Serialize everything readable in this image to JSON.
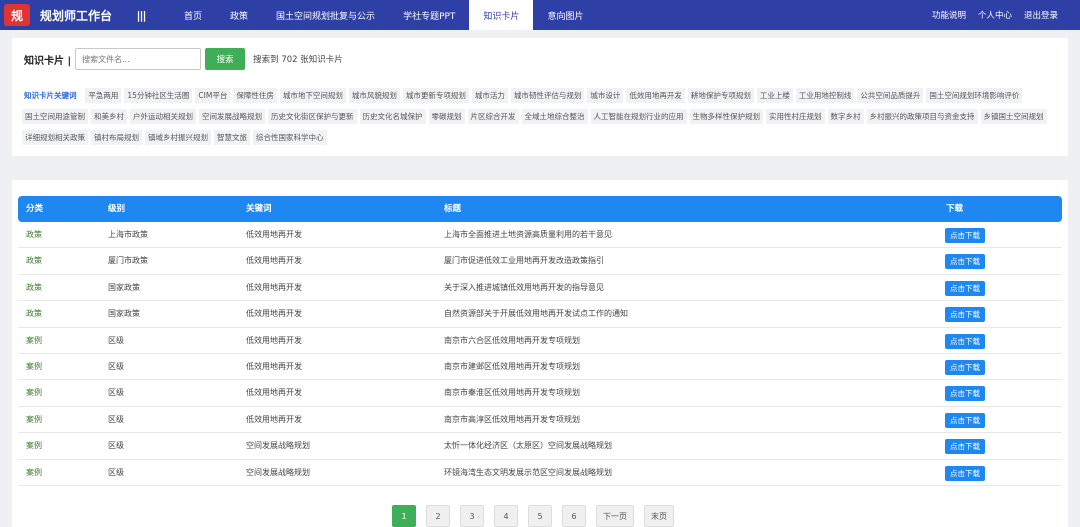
{
  "header": {
    "logo_text": "规",
    "title": "规划师工作台",
    "menu_glyph": "|||",
    "nav": [
      "首页",
      "政策",
      "国土空间规划批复与公示",
      "学社专题PPT",
      "知识卡片",
      "意向图片"
    ],
    "active_nav_index": 4,
    "links": [
      "功能说明",
      "个人中心",
      "退出登录"
    ]
  },
  "search": {
    "label": "知识卡片 |",
    "placeholder": "搜索文件名...",
    "button": "搜索",
    "result_text": "搜索到 702 张知识卡片"
  },
  "keywords": {
    "label": "知识卡片关键词",
    "tags": [
      "平急两用",
      "15分钟社区生活圈",
      "CIM平台",
      "保障性住房",
      "城市地下空间规划",
      "城市风貌规划",
      "城市更新专项规划",
      "城市活力",
      "城市韧性评估与规划",
      "城市设计",
      "低效用地再开发",
      "耕地保护专项规划",
      "工业上楼",
      "工业用地控制线",
      "公共空间品质提升",
      "国土空间规划环境影响评价",
      "国土空间用途管制",
      "和美乡村",
      "户外运动相关规划",
      "空间发展战略规划",
      "历史文化街区保护与更新",
      "历史文化名城保护",
      "零碳规划",
      "片区综合开发",
      "全域土地综合整治",
      "人工智能在规划行业的应用",
      "生物多样性保护规划",
      "实用性村庄规划",
      "数字乡村",
      "乡村振兴的政策项目与资金支持",
      "乡镇国土空间规划",
      "详细规划相关政策",
      "镇村布局规划",
      "镇域乡村振兴规划",
      "智慧文旅",
      "综合性国家科学中心"
    ]
  },
  "table": {
    "headers": [
      "分类",
      "级别",
      "关键词",
      "标题",
      "下载"
    ],
    "download_label": "点击下载",
    "rows": [
      [
        "政策",
        "上海市政策",
        "低效用地再开发",
        "上海市全面推进土地资源高质量利用的若干意见"
      ],
      [
        "政策",
        "厦门市政策",
        "低效用地再开发",
        "厦门市促进低效工业用地再开发改造政策指引"
      ],
      [
        "政策",
        "国家政策",
        "低效用地再开发",
        "关于深入推进城镇低效用地再开发的指导意见"
      ],
      [
        "政策",
        "国家政策",
        "低效用地再开发",
        "自然资源部关于开展低效用地再开发试点工作的通知"
      ],
      [
        "案例",
        "区级",
        "低效用地再开发",
        "南京市六合区低效用地再开发专项规划"
      ],
      [
        "案例",
        "区级",
        "低效用地再开发",
        "南京市建邺区低效用地再开发专项规划"
      ],
      [
        "案例",
        "区级",
        "低效用地再开发",
        "南京市秦淮区低效用地再开发专项规划"
      ],
      [
        "案例",
        "区级",
        "低效用地再开发",
        "南京市高淳区低效用地再开发专项规划"
      ],
      [
        "案例",
        "区级",
        "空间发展战略规划",
        "太忻一体化经济区（太原区）空间发展战略规划"
      ],
      [
        "案例",
        "区级",
        "空间发展战略规划",
        "环镜海湾生态文明发展示范区空间发展战略规划"
      ]
    ]
  },
  "pagination": {
    "pages": [
      "1",
      "2",
      "3",
      "4",
      "5",
      "6",
      "下一页",
      "末页"
    ],
    "active_index": 0
  },
  "colors": {
    "nav_bg": "#2e3fa6",
    "accent_blue": "#1e88f0",
    "search_green": "#3fae58",
    "category_green": "#3c7a2a"
  }
}
